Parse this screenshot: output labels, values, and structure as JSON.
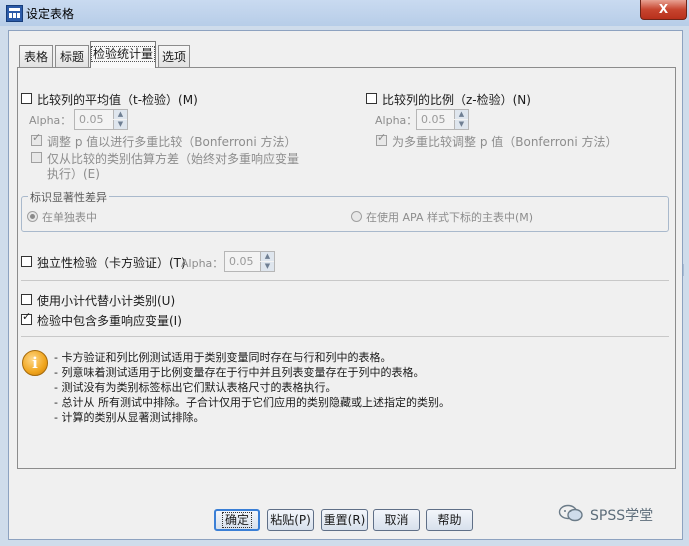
{
  "window": {
    "title": "设定表格",
    "close_label": "X"
  },
  "tabs": [
    {
      "label": "表格"
    },
    {
      "label": "标题"
    },
    {
      "label": "检验统计量"
    },
    {
      "label": "选项"
    }
  ],
  "means_test": {
    "label": "比较列的平均值（t-检验）(M)",
    "checked": false,
    "alpha_label": "Alpha：",
    "alpha_value": "0.05",
    "adjust_label": "调整 p 值以进行多重比较（Bonferroni 方法）",
    "adjust_checked": true,
    "variance_label_line1": "仅从比较的类别估算方差（始终对多重响应变量",
    "variance_label_line2": "执行）(E)",
    "variance_checked": false
  },
  "proportions_test": {
    "label": "比较列的比例（z-检验）(N)",
    "checked": false,
    "alpha_label": "Alpha：",
    "alpha_value": "0.05",
    "adjust_label": "为多重比较调整 p 值（Bonferroni 方法）",
    "adjust_checked": true
  },
  "significance": {
    "legend": "标识显著性差异",
    "option_same_table": "在单独表中",
    "option_apa": "在使用 APA 样式下标的主表中(M)",
    "selected": "在单独表中"
  },
  "independence": {
    "label": "独立性检验（卡方验证）(T)",
    "checked": false,
    "alpha_label": "Alpha：",
    "alpha_value": "0.05"
  },
  "subtotals": {
    "label": "使用小计代替小计类别(U)",
    "checked": false
  },
  "multiple_response": {
    "label": "检验中包含多重响应变量(I)",
    "checked": true
  },
  "info": {
    "icon_glyph": "i",
    "lines": [
      "- 卡方验证和列比例测试适用于类别变量同时存在与行和列中的表格。",
      "- 列意味着测试适用于比例变量存在于行中并且列表变量存在于列中的表格。",
      "- 测试没有为类别标签标出它们默认表格尺寸的表格执行。",
      "- 总计从 所有测试中排除。子合计仅用于它们应用的类别隐藏或上述指定的类别。",
      "- 计算的类别从显著测试排除。"
    ]
  },
  "buttons": {
    "ok": "确定",
    "paste": "粘贴(P)",
    "reset": "重置(R)",
    "cancel": "取消",
    "help": "帮助"
  },
  "watermark": {
    "text": "SPSS学堂",
    "icon": "wechat-icon"
  },
  "colors": {
    "accent": "#3a7fd6",
    "titlebar": "#c9daf0",
    "close": "#c7452f"
  }
}
